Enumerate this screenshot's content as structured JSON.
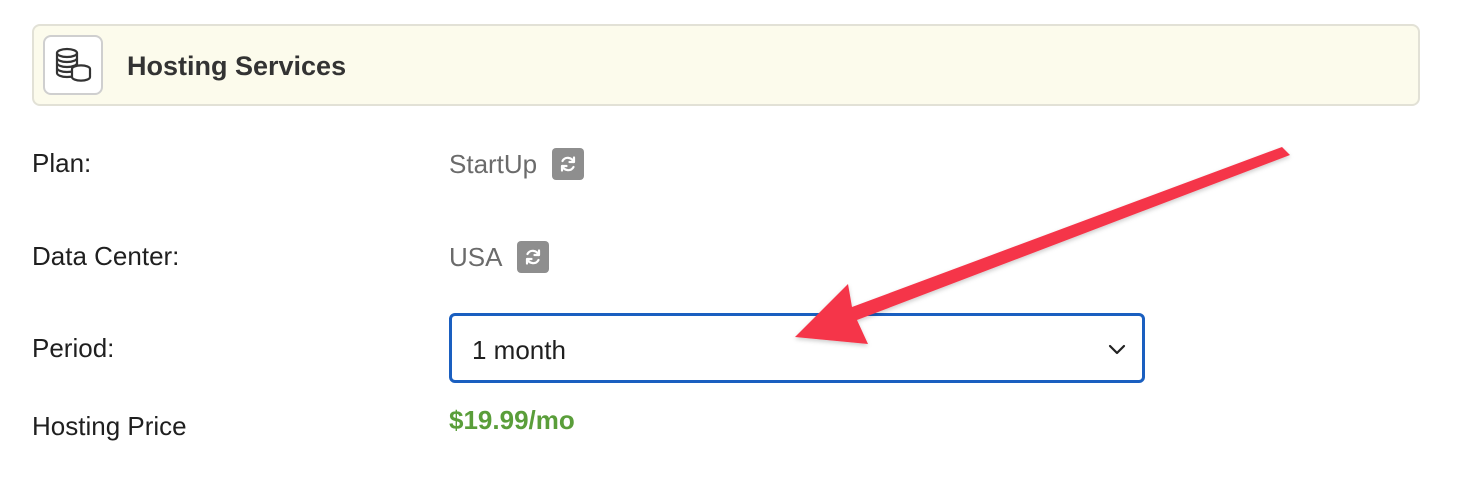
{
  "header": {
    "title": "Hosting Services",
    "icon": "coins-stack-icon"
  },
  "rows": {
    "plan": {
      "label": "Plan:",
      "value": "StartUp"
    },
    "data_center": {
      "label": "Data Center:",
      "value": "USA"
    },
    "period": {
      "label": "Period:",
      "selected": "1 month"
    },
    "price": {
      "label": "Hosting Price",
      "value": "$19.99/mo"
    }
  },
  "colors": {
    "header_bg": "#fcfbec",
    "select_border": "#1a5fc0",
    "price_text": "#5a9e3a",
    "annotation_arrow": "#f5364a",
    "refresh_button": "#8e8e8e"
  }
}
